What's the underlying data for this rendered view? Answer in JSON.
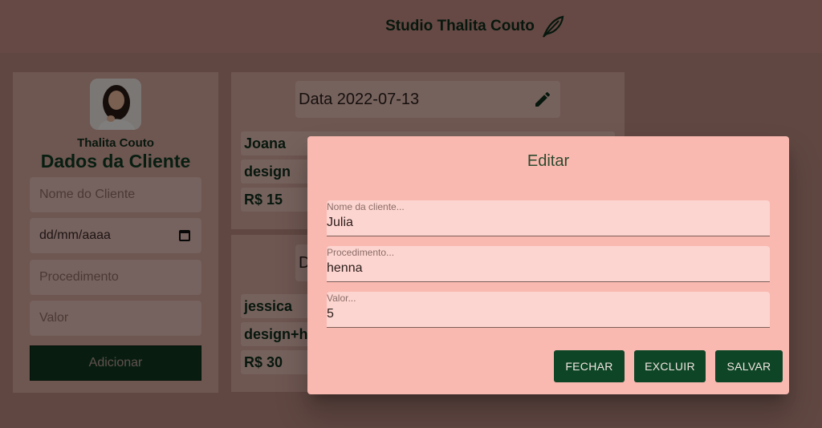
{
  "header": {
    "brand": "Studio Thalita Couto",
    "icon": "leaf-icon"
  },
  "form": {
    "profile_name": "Thalita Couto",
    "title": "Dados da Cliente",
    "name_placeholder": "Nome do Cliente",
    "date_placeholder": "dd/mm/aaaa",
    "procedure_placeholder": "Procedimento",
    "value_placeholder": "Valor",
    "add_label": "Adicionar"
  },
  "cards": [
    {
      "date": "Data 2022-07-13",
      "name": "Joana",
      "procedure": "design",
      "value": "R$ 15"
    },
    {
      "date": "D",
      "name": "jessica",
      "procedure": "design+h",
      "value": "R$ 30"
    }
  ],
  "dialog": {
    "title": "Editar",
    "fields": [
      {
        "label": "Nome da cliente...",
        "value": "Julia"
      },
      {
        "label": "Procedimento...",
        "value": "henna"
      },
      {
        "label": "Valor...",
        "value": "5"
      }
    ],
    "buttons": {
      "close": "FECHAR",
      "delete": "EXCLUIR",
      "save": "SALVAR"
    }
  },
  "colors": {
    "accent": "#0e4526",
    "dialog_bg": "#f9b9b0",
    "page_bg": "#bf8f86"
  }
}
